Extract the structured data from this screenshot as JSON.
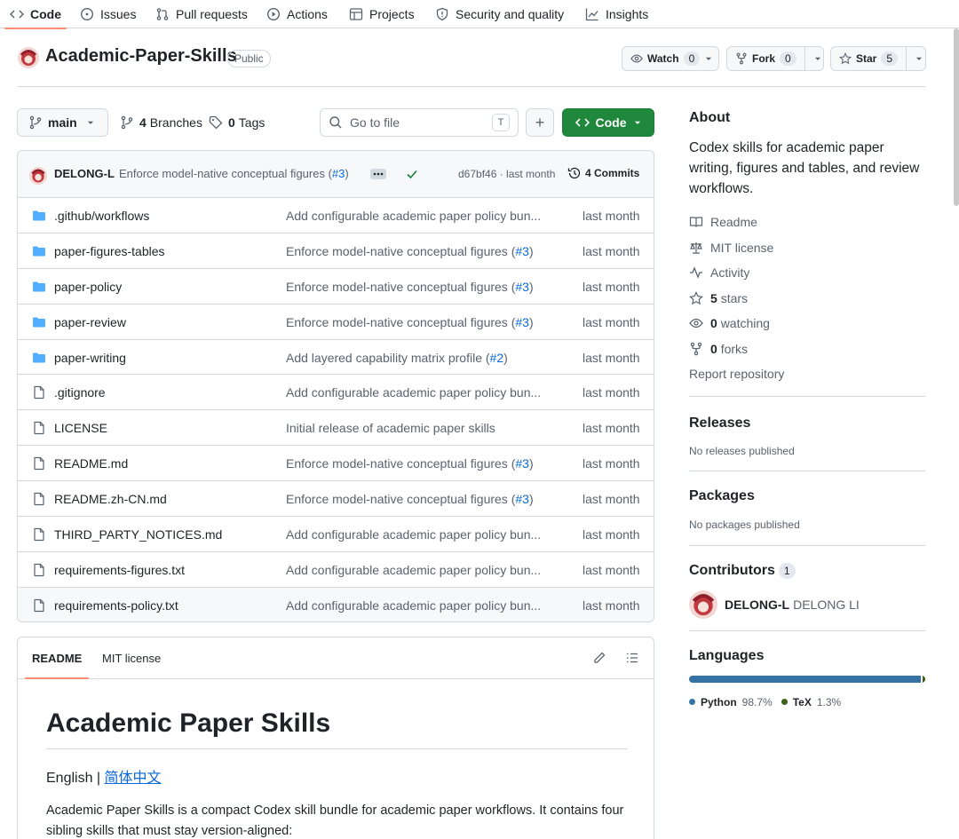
{
  "nav": {
    "tabs": [
      {
        "label": "Code",
        "icon": "code-icon",
        "active": true
      },
      {
        "label": "Issues",
        "icon": "issue-icon"
      },
      {
        "label": "Pull requests",
        "icon": "pull-request-icon"
      },
      {
        "label": "Actions",
        "icon": "play-icon"
      },
      {
        "label": "Projects",
        "icon": "table-icon"
      },
      {
        "label": "Security and quality",
        "icon": "shield-icon"
      },
      {
        "label": "Insights",
        "icon": "graph-icon"
      }
    ]
  },
  "repo": {
    "name": "Academic-Paper-Skills",
    "visibility": "Public",
    "watch_label": "Watch",
    "watch_count": "0",
    "fork_label": "Fork",
    "fork_count": "0",
    "star_label": "Star",
    "star_count": "5"
  },
  "toolbar": {
    "branch": "main",
    "branches_count": "4",
    "branches_label": "Branches",
    "tags_count": "0",
    "tags_label": "Tags",
    "search_placeholder": "Go to file",
    "search_shortcut": "T",
    "add_label": "+",
    "code_label": "Code"
  },
  "commit": {
    "author": "DELONG-L",
    "message": "Enforce model-native conceptual figures (",
    "pr_link": "#3",
    "message_end": ")",
    "sha": "d67bf46 · last month",
    "commits_label": "4 Commits"
  },
  "files": [
    {
      "type": "dir",
      "name": ".github/workflows",
      "msg": "Add configurable academic paper policy bun...",
      "link": "",
      "date": "last month"
    },
    {
      "type": "dir",
      "name": "paper-figures-tables",
      "msg": "Enforce model-native conceptual figures (",
      "link": "#3",
      "date": "last month"
    },
    {
      "type": "dir",
      "name": "paper-policy",
      "msg": "Enforce model-native conceptual figures (",
      "link": "#3",
      "date": "last month"
    },
    {
      "type": "dir",
      "name": "paper-review",
      "msg": "Enforce model-native conceptual figures (",
      "link": "#3",
      "date": "last month"
    },
    {
      "type": "dir",
      "name": "paper-writing",
      "msg": "Add layered capability matrix profile (",
      "link": "#2",
      "date": "last month"
    },
    {
      "type": "file",
      "name": ".gitignore",
      "msg": "Add configurable academic paper policy bun...",
      "link": "",
      "date": "last month"
    },
    {
      "type": "file",
      "name": "LICENSE",
      "msg": "Initial release of academic paper skills",
      "link": "",
      "date": "last month"
    },
    {
      "type": "file",
      "name": "README.md",
      "msg": "Enforce model-native conceptual figures (",
      "link": "#3",
      "date": "last month"
    },
    {
      "type": "file",
      "name": "README.zh-CN.md",
      "msg": "Enforce model-native conceptual figures (",
      "link": "#3",
      "date": "last month"
    },
    {
      "type": "file",
      "name": "THIRD_PARTY_NOTICES.md",
      "msg": "Add configurable academic paper policy bun...",
      "link": "",
      "date": "last month"
    },
    {
      "type": "file",
      "name": "requirements-figures.txt",
      "msg": "Add configurable academic paper policy bun...",
      "link": "",
      "date": "last month"
    },
    {
      "type": "file",
      "name": "requirements-policy.txt",
      "msg": "Add configurable academic paper policy bun...",
      "link": "",
      "date": "last month"
    }
  ],
  "readme": {
    "tab_readme": "README",
    "tab_license": "MIT license",
    "title": "Academic Paper Skills",
    "lang_english": "English | ",
    "lang_chinese": "简体中文",
    "intro": "Academic Paper Skills is a compact Codex skill bundle for academic paper workflows. It contains four sibling skills that must stay version-aligned:"
  },
  "about": {
    "heading": "About",
    "description": "Codex skills for academic paper writing, figures and tables, and review workflows.",
    "items": [
      {
        "icon": "book-icon",
        "label": "Readme"
      },
      {
        "icon": "law-icon",
        "label": "MIT license"
      },
      {
        "icon": "pulse-icon",
        "label": "Activity"
      },
      {
        "icon": "star-icon",
        "count": "5",
        "label": "stars"
      },
      {
        "icon": "eye-icon",
        "count": "0",
        "label": "watching"
      },
      {
        "icon": "fork-icon",
        "count": "0",
        "label": "forks"
      }
    ],
    "report": "Report repository"
  },
  "releases": {
    "heading": "Releases",
    "text": "No releases published"
  },
  "packages": {
    "heading": "Packages",
    "text": "No packages published"
  },
  "contributors": {
    "heading": "Contributors",
    "count": "1",
    "login": "DELONG-L",
    "fullname": "DELONG LI"
  },
  "languages": {
    "heading": "Languages",
    "items": [
      {
        "name": "Python",
        "percent": "98.7%",
        "value": 98.7,
        "color": "#3572A5"
      },
      {
        "name": "TeX",
        "percent": "1.3%",
        "value": 1.3,
        "color": "#3D6117"
      }
    ]
  }
}
